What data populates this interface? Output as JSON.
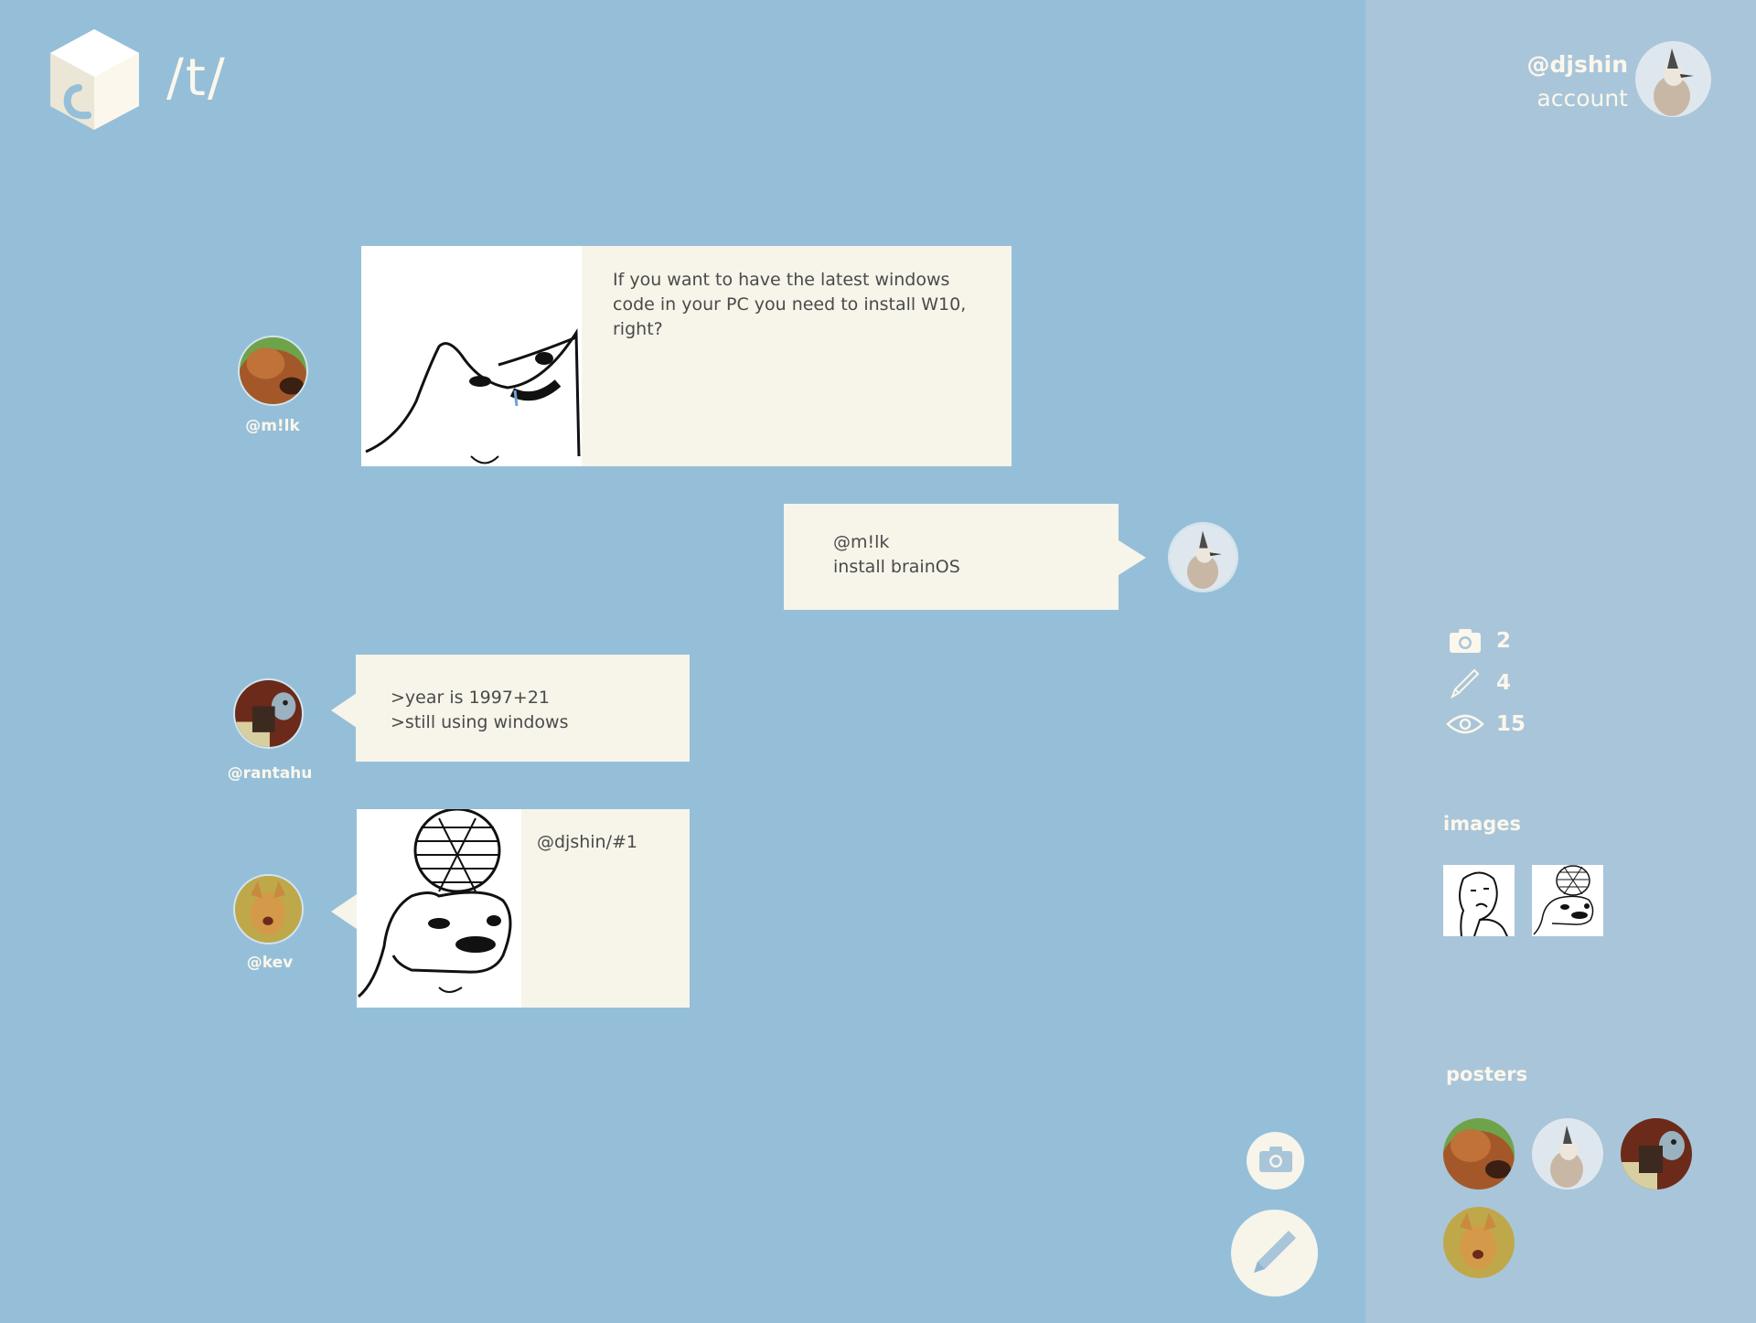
{
  "header": {
    "board": "/t/"
  },
  "account": {
    "username": "@djshin",
    "link": "account"
  },
  "posts": [
    {
      "user": "@m!lk",
      "text": "If you want to have the latest windows code in your PC you need to install W10, right?",
      "has_image": true
    },
    {
      "user": "@djshin",
      "mention": "@m!lk",
      "text": "install brainOS",
      "has_image": false
    },
    {
      "user": "@rantahu",
      "lines": [
        ">year is 1997+21",
        ">still using windows"
      ],
      "has_image": false
    },
    {
      "user": "@kev",
      "mention": "@djshin/#1",
      "has_image": true
    }
  ],
  "stats": {
    "images": "2",
    "posts": "4",
    "views": "15"
  },
  "sidebar": {
    "images_title": "images",
    "posters_title": "posters"
  },
  "icons": [
    "cube-logo",
    "camera-icon",
    "pencil-icon",
    "eye-icon"
  ],
  "colors": {
    "background": "#95bfd8",
    "sidebar": "#a9c5d9",
    "bubble": "#f7f4ea",
    "greentext": "#5a9e46",
    "mention": "#8fb7d2"
  }
}
